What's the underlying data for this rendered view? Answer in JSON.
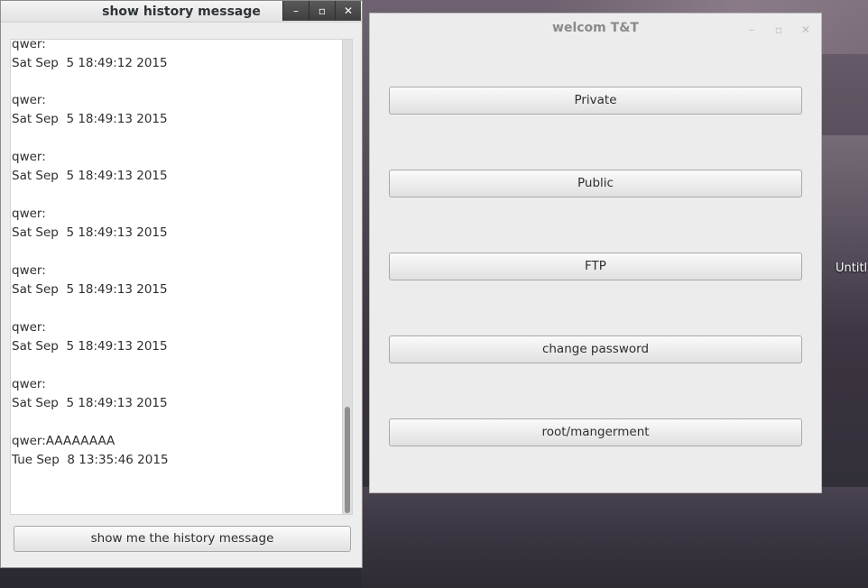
{
  "desktop": {
    "label": "Untitl"
  },
  "history_window": {
    "title": "show history message",
    "controls": [
      "–",
      "▫",
      "✕"
    ],
    "messages": [
      {
        "sender": "qwer:",
        "time": "Sat Sep  5 18:49:12 2015"
      },
      {
        "sender": "qwer:",
        "time": "Sat Sep  5 18:49:13 2015"
      },
      {
        "sender": "qwer:",
        "time": "Sat Sep  5 18:49:13 2015"
      },
      {
        "sender": "qwer:",
        "time": "Sat Sep  5 18:49:13 2015"
      },
      {
        "sender": "qwer:",
        "time": "Sat Sep  5 18:49:13 2015"
      },
      {
        "sender": "qwer:",
        "time": "Sat Sep  5 18:49:13 2015"
      },
      {
        "sender": "qwer:",
        "time": "Sat Sep  5 18:49:13 2015"
      },
      {
        "sender": "qwer:AAAAAAAA",
        "time": "Tue Sep  8 13:35:46 2015"
      }
    ],
    "button_label": "show me the history message"
  },
  "welcome_window": {
    "title": "welcom T&T",
    "controls": [
      "–",
      "▫",
      "✕"
    ],
    "buttons": [
      "Private",
      "Public",
      "FTP",
      "change password",
      "root/mangerment"
    ]
  }
}
